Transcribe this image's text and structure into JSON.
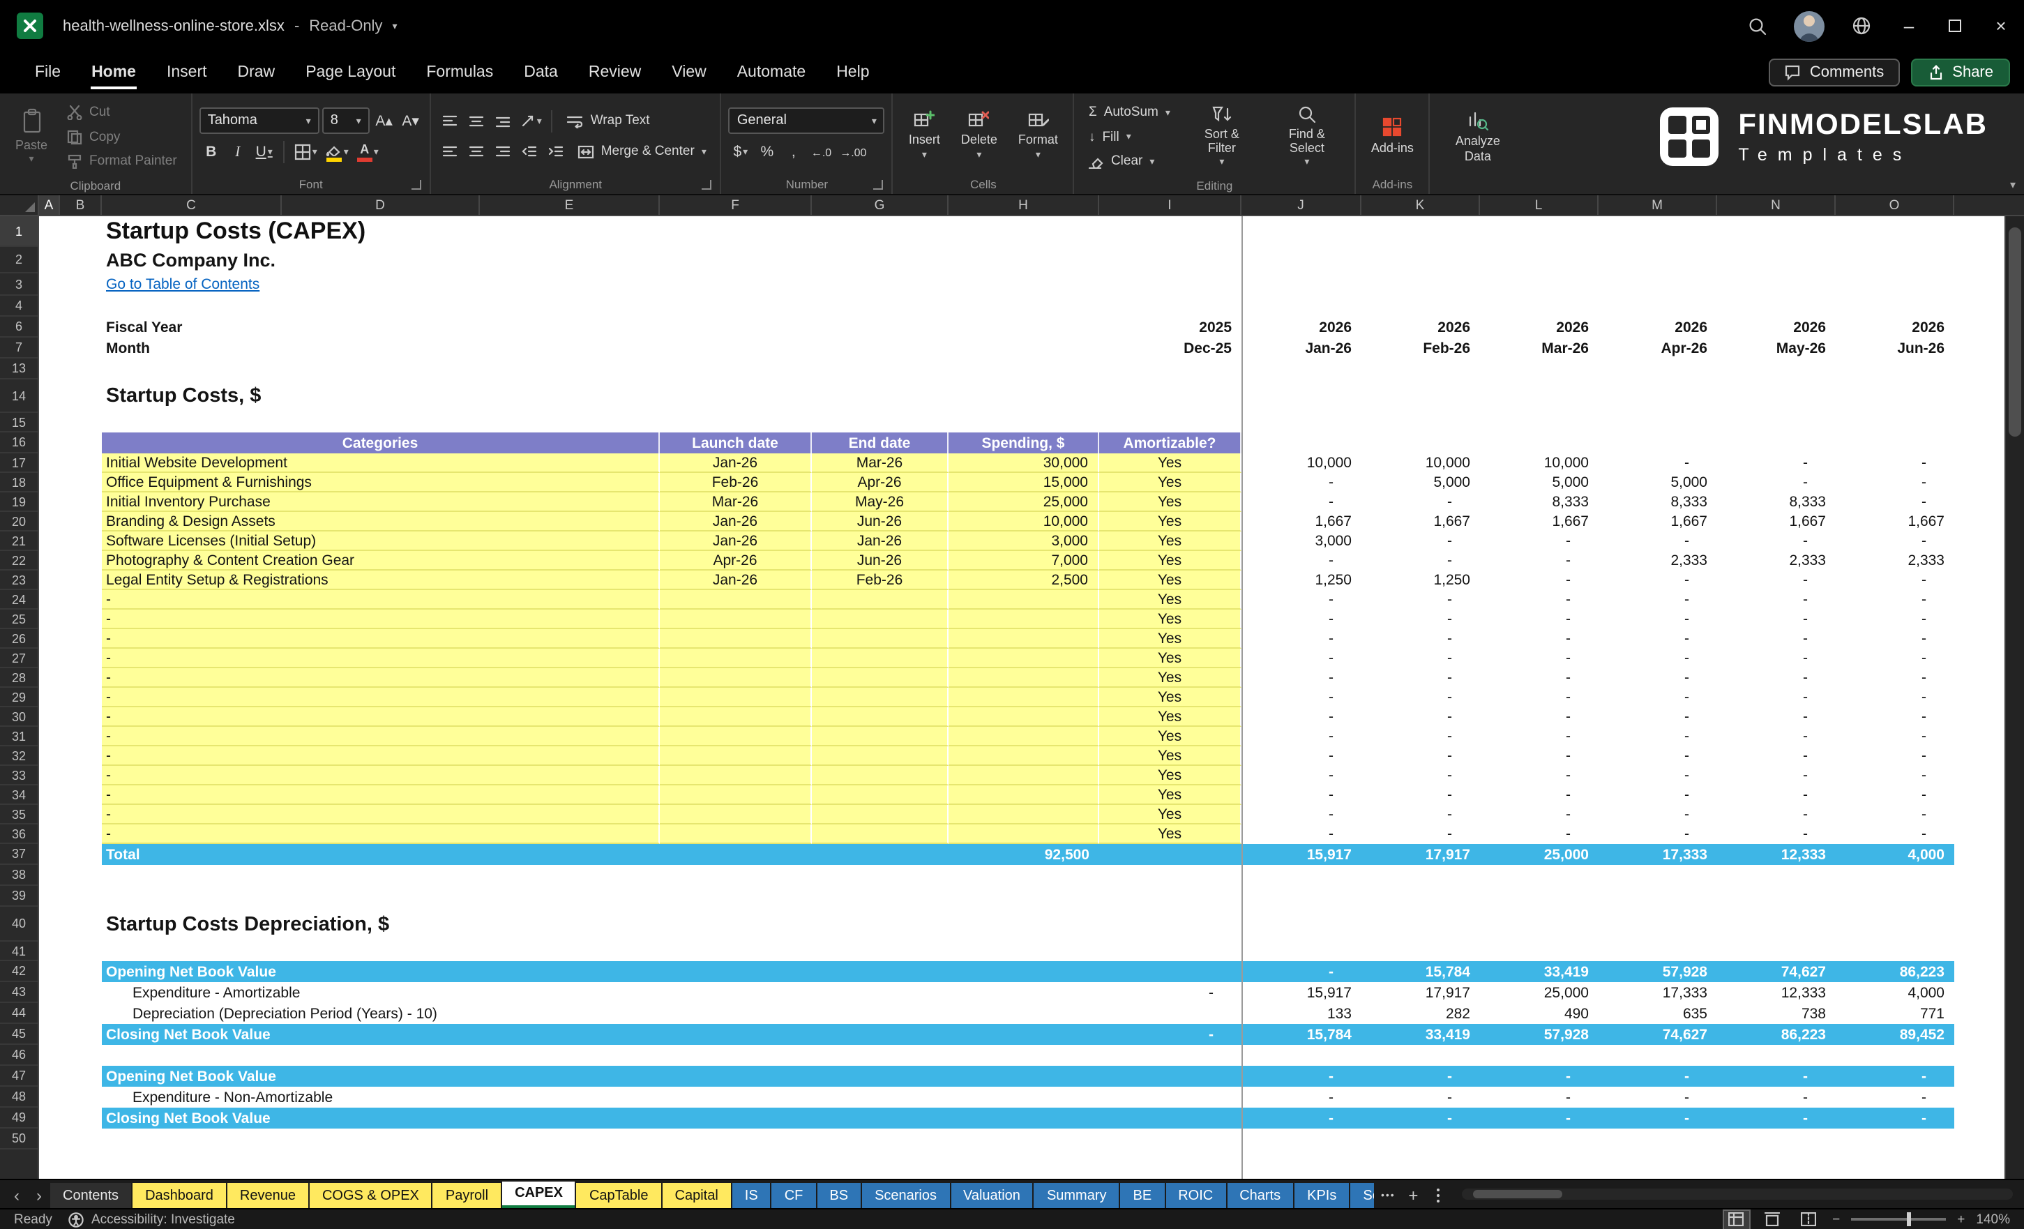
{
  "titlebar": {
    "filename": "health-wellness-online-store.xlsx",
    "separator": "-",
    "mode": "Read-Only"
  },
  "menubar": {
    "items": [
      "File",
      "Home",
      "Insert",
      "Draw",
      "Page Layout",
      "Formulas",
      "Data",
      "Review",
      "View",
      "Automate",
      "Help"
    ],
    "active": "Home",
    "comments": "Comments",
    "share": "Share"
  },
  "ribbon": {
    "clipboard": {
      "group": "Clipboard",
      "paste": "Paste",
      "cut": "Cut",
      "copy": "Copy",
      "format_painter": "Format Painter"
    },
    "font": {
      "group": "Font",
      "name": "Tahoma",
      "size": "8"
    },
    "alignment": {
      "group": "Alignment",
      "wrap_text": "Wrap Text",
      "merge_center": "Merge & Center"
    },
    "number": {
      "group": "Number",
      "format": "General"
    },
    "cells": {
      "group": "Cells",
      "insert": "Insert",
      "delete": "Delete",
      "format": "Format"
    },
    "editing": {
      "group": "Editing",
      "autosum": "AutoSum",
      "fill": "Fill",
      "clear": "Clear",
      "sort_filter": "Sort & Filter",
      "find_select": "Find & Select"
    },
    "addins": {
      "group": "Add-ins",
      "label": "Add-ins"
    },
    "analyze": {
      "label": "Analyze Data"
    }
  },
  "brand": {
    "name": "FINMODELSLAB",
    "subtitle": "Templates"
  },
  "icons": {
    "dropdown": "▾",
    "nav_left": "‹",
    "nav_right": "›",
    "more": "•••",
    "add_sheet": "+",
    "minimize": "–",
    "close": "×",
    "autosum": "Σ",
    "bold": "B",
    "italic": "I",
    "underline": "U",
    "dollar": "$",
    "percent": "%",
    "comma": ",",
    "increase_decimal": "←.0",
    "decrease_decimal": "→.00",
    "increase_font": "A▴",
    "decrease_font": "A▾",
    "fill_down": "↓",
    "zoom_out": "−",
    "zoom_in": "+"
  },
  "grid": {
    "columns": [
      "A",
      "B",
      "C",
      "D",
      "E",
      "F",
      "G",
      "H",
      "I",
      "J",
      "K",
      "L",
      "M",
      "N",
      "O"
    ],
    "row_numbers": [
      1,
      2,
      3,
      4,
      6,
      7,
      13,
      14,
      15,
      16,
      17,
      18,
      19,
      20,
      21,
      22,
      23,
      24,
      25,
      26,
      27,
      28,
      29,
      30,
      31,
      32,
      33,
      34,
      35,
      36,
      37,
      38,
      39,
      40,
      41,
      42,
      43,
      44,
      45,
      46,
      47,
      48,
      49,
      50
    ],
    "title": "Startup Costs (CAPEX)",
    "company": "ABC Company Inc.",
    "toc_link": "Go to Table of Contents",
    "fiscal_row": {
      "label": "Fiscal Year",
      "dec": "2025",
      "months": [
        "2026",
        "2026",
        "2026",
        "2026",
        "2026",
        "2026"
      ]
    },
    "month_row": {
      "label": "Month",
      "dec": "Dec-25",
      "months": [
        "Jan-26",
        "Feb-26",
        "Mar-26",
        "Apr-26",
        "May-26",
        "Jun-26"
      ]
    },
    "section1_title": "Startup Costs, $",
    "table_headers": [
      "Categories",
      "Launch date",
      "End date",
      "Spending, $",
      "Amortizable?"
    ],
    "capex_rows": [
      {
        "category": "Initial Website Development",
        "launch": "Jan-26",
        "end": "Mar-26",
        "spending": "30,000",
        "amortizable": "Yes",
        "values": [
          "10,000",
          "10,000",
          "10,000",
          "-",
          "-",
          "-"
        ]
      },
      {
        "category": "Office Equipment & Furnishings",
        "launch": "Feb-26",
        "end": "Apr-26",
        "spending": "15,000",
        "amortizable": "Yes",
        "values": [
          "-",
          "5,000",
          "5,000",
          "5,000",
          "-",
          "-"
        ]
      },
      {
        "category": "Initial Inventory Purchase",
        "launch": "Mar-26",
        "end": "May-26",
        "spending": "25,000",
        "amortizable": "Yes",
        "values": [
          "-",
          "-",
          "8,333",
          "8,333",
          "8,333",
          "-"
        ]
      },
      {
        "category": "Branding & Design Assets",
        "launch": "Jan-26",
        "end": "Jun-26",
        "spending": "10,000",
        "amortizable": "Yes",
        "values": [
          "1,667",
          "1,667",
          "1,667",
          "1,667",
          "1,667",
          "1,667"
        ]
      },
      {
        "category": "Software Licenses (Initial Setup)",
        "launch": "Jan-26",
        "end": "Jan-26",
        "spending": "3,000",
        "amortizable": "Yes",
        "values": [
          "3,000",
          "-",
          "-",
          "-",
          "-",
          "-"
        ]
      },
      {
        "category": "Photography & Content Creation Gear",
        "launch": "Apr-26",
        "end": "Jun-26",
        "spending": "7,000",
        "amortizable": "Yes",
        "values": [
          "-",
          "-",
          "-",
          "2,333",
          "2,333",
          "2,333"
        ]
      },
      {
        "category": "Legal Entity Setup & Registrations",
        "launch": "Jan-26",
        "end": "Feb-26",
        "spending": "2,500",
        "amortizable": "Yes",
        "values": [
          "1,250",
          "1,250",
          "-",
          "-",
          "-",
          "-"
        ]
      },
      {
        "category": "-",
        "launch": "",
        "end": "",
        "spending": "",
        "amortizable": "Yes",
        "values": [
          "-",
          "-",
          "-",
          "-",
          "-",
          "-"
        ]
      },
      {
        "category": "-",
        "launch": "",
        "end": "",
        "spending": "",
        "amortizable": "Yes",
        "values": [
          "-",
          "-",
          "-",
          "-",
          "-",
          "-"
        ]
      },
      {
        "category": "-",
        "launch": "",
        "end": "",
        "spending": "",
        "amortizable": "Yes",
        "values": [
          "-",
          "-",
          "-",
          "-",
          "-",
          "-"
        ]
      },
      {
        "category": "-",
        "launch": "",
        "end": "",
        "spending": "",
        "amortizable": "Yes",
        "values": [
          "-",
          "-",
          "-",
          "-",
          "-",
          "-"
        ]
      },
      {
        "category": "-",
        "launch": "",
        "end": "",
        "spending": "",
        "amortizable": "Yes",
        "values": [
          "-",
          "-",
          "-",
          "-",
          "-",
          "-"
        ]
      },
      {
        "category": "-",
        "launch": "",
        "end": "",
        "spending": "",
        "amortizable": "Yes",
        "values": [
          "-",
          "-",
          "-",
          "-",
          "-",
          "-"
        ]
      },
      {
        "category": "-",
        "launch": "",
        "end": "",
        "spending": "",
        "amortizable": "Yes",
        "values": [
          "-",
          "-",
          "-",
          "-",
          "-",
          "-"
        ]
      },
      {
        "category": "-",
        "launch": "",
        "end": "",
        "spending": "",
        "amortizable": "Yes",
        "values": [
          "-",
          "-",
          "-",
          "-",
          "-",
          "-"
        ]
      },
      {
        "category": "-",
        "launch": "",
        "end": "",
        "spending": "",
        "amortizable": "Yes",
        "values": [
          "-",
          "-",
          "-",
          "-",
          "-",
          "-"
        ]
      },
      {
        "category": "-",
        "launch": "",
        "end": "",
        "spending": "",
        "amortizable": "Yes",
        "values": [
          "-",
          "-",
          "-",
          "-",
          "-",
          "-"
        ]
      },
      {
        "category": "-",
        "launch": "",
        "end": "",
        "spending": "",
        "amortizable": "Yes",
        "values": [
          "-",
          "-",
          "-",
          "-",
          "-",
          "-"
        ]
      },
      {
        "category": "-",
        "launch": "",
        "end": "",
        "spending": "",
        "amortizable": "Yes",
        "values": [
          "-",
          "-",
          "-",
          "-",
          "-",
          "-"
        ]
      },
      {
        "category": "-",
        "launch": "",
        "end": "",
        "spending": "",
        "amortizable": "Yes",
        "values": [
          "-",
          "-",
          "-",
          "-",
          "-",
          "-"
        ]
      }
    ],
    "total_row": {
      "label": "Total",
      "spending": "92,500",
      "values": [
        "15,917",
        "17,917",
        "25,000",
        "17,333",
        "12,333",
        "4,000"
      ]
    },
    "section2_title": "Startup Costs Depreciation, $",
    "depreciation_rows": [
      {
        "label": "Opening Net Book Value",
        "style": "total",
        "col_i": "",
        "values": [
          "-",
          "15,784",
          "33,419",
          "57,928",
          "74,627",
          "86,223"
        ]
      },
      {
        "label": "Expenditure - Amortizable",
        "style": "normal",
        "col_i": "-",
        "values": [
          "15,917",
          "17,917",
          "25,000",
          "17,333",
          "12,333",
          "4,000"
        ]
      },
      {
        "label": "Depreciation (Depreciation Period (Years) - 10)",
        "style": "normal",
        "col_i": "",
        "values": [
          "133",
          "282",
          "490",
          "635",
          "738",
          "771"
        ]
      },
      {
        "label": "Closing Net Book Value",
        "style": "total",
        "col_i": "-",
        "values": [
          "15,784",
          "33,419",
          "57,928",
          "74,627",
          "86,223",
          "89,452"
        ]
      }
    ],
    "non_amortizable_rows": [
      {
        "label": "Opening Net Book Value",
        "style": "total",
        "col_i": "",
        "values": [
          "-",
          "-",
          "-",
          "-",
          "-",
          "-"
        ]
      },
      {
        "label": "Expenditure - Non-Amortizable",
        "style": "normal",
        "col_i": "",
        "values": [
          "-",
          "-",
          "-",
          "-",
          "-",
          "-"
        ]
      },
      {
        "label": "Closing Net Book Value",
        "style": "total",
        "col_i": "",
        "values": [
          "-",
          "-",
          "-",
          "-",
          "-",
          "-"
        ]
      }
    ]
  },
  "sheet_tabs": {
    "items": [
      {
        "label": "Contents",
        "style": "plain"
      },
      {
        "label": "Dashboard",
        "style": "yellow"
      },
      {
        "label": "Revenue",
        "style": "yellow"
      },
      {
        "label": "COGS & OPEX",
        "style": "yellow"
      },
      {
        "label": "Payroll",
        "style": "yellow"
      },
      {
        "label": "CAPEX",
        "style": "active"
      },
      {
        "label": "CapTable",
        "style": "yellow"
      },
      {
        "label": "Capital",
        "style": "yellow"
      },
      {
        "label": "IS",
        "style": "blue"
      },
      {
        "label": "CF",
        "style": "blue"
      },
      {
        "label": "BS",
        "style": "blue"
      },
      {
        "label": "Scenarios",
        "style": "blue"
      },
      {
        "label": "Valuation",
        "style": "blue"
      },
      {
        "label": "Summary",
        "style": "blue"
      },
      {
        "label": "BE",
        "style": "blue"
      },
      {
        "label": "ROIC",
        "style": "blue"
      },
      {
        "label": "Charts",
        "style": "blue"
      },
      {
        "label": "KPIs",
        "style": "blue"
      },
      {
        "label": "Sc",
        "style": "blue",
        "truncated": true
      }
    ]
  },
  "statusbar": {
    "ready": "Ready",
    "accessibility": "Accessibility: Investigate",
    "zoom": "140%"
  },
  "colors": {
    "header_purple": "#7e7ec8",
    "row_yellow": "#ffff99",
    "band_cyan": "#3eb6e6",
    "tab_yellow": "#ffe95f",
    "tab_blue": "#2e75b6",
    "link_blue": "#0563c1",
    "excel_green": "#107c41"
  }
}
